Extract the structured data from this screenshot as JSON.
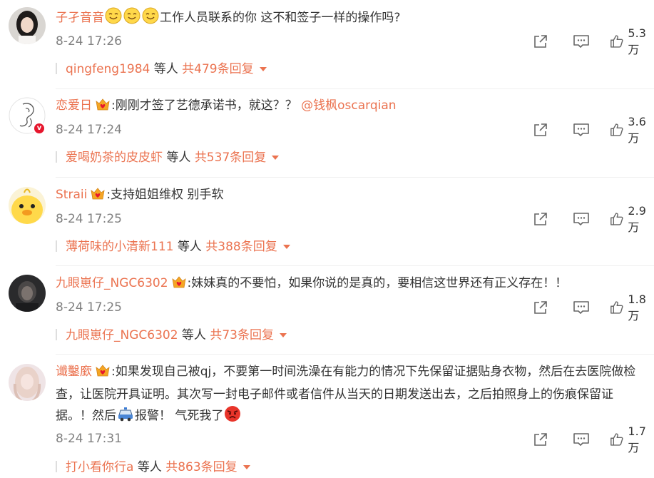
{
  "comments": [
    {
      "user": "子孑音音",
      "emojis": [
        "smile-emoji",
        "smile-emoji",
        "smile-emoji"
      ],
      "text": "工作人员联系的你 这不和签子一样的操作吗?",
      "time": "8-24 17:26",
      "likes": "5.3万",
      "reply_user": "qingfeng1984",
      "reply_mid": " 等人 ",
      "reply_total": "共479条回复"
    },
    {
      "user": "恋爱日",
      "text": ":刚刚才签了艺德承诺书，就这？？",
      "mention": "@钱枫oscarqian",
      "time": "8-24 17:24",
      "likes": "3.6万",
      "reply_user": "爱喝奶茶的皮皮虾",
      "reply_mid": " 等人 ",
      "reply_total": "共537条回复"
    },
    {
      "user": "Straii",
      "text": ":支持姐姐维权 别手软",
      "time": "8-24 17:25",
      "likes": "2.9万",
      "reply_user": "薄荷味的小清新111",
      "reply_mid": " 等人 ",
      "reply_total": "共388条回复"
    },
    {
      "user": "九眼崽仔_NGC6302",
      "text": ":妹妹真的不要怕，如果你说的是真的，要相信这世界还有正义存在！！",
      "time": "8-24 17:25",
      "likes": "1.8万",
      "reply_user": "九眼崽仔_NGC6302",
      "reply_mid": " 等人 ",
      "reply_total": "共73条回复"
    },
    {
      "user": "谶鑿廞",
      "text_a": ":如果发现自己被qj，不要第一时间洗澡在有能力的情况下先保留证据贴身衣物，然后在去医院做检查，让医院开具证明。其次写一封电子邮件或者信件从当天的日期发送出去，之后拍照身上的伤痕保留证据。！然后",
      "text_b": "报警！ 气死我了",
      "time": "8-24 17:31",
      "likes": "1.7万",
      "reply_user": "打小看你行a",
      "reply_mid": " 等人 ",
      "reply_total": "共863条回复"
    }
  ],
  "colors": {
    "accent": "#eb7350",
    "text": "#333333",
    "meta": "#808080",
    "icon": "#666666",
    "verified": "#e6162d"
  },
  "icons": {
    "share": "share-icon",
    "comment": "comment-icon",
    "like": "thumb-up-icon",
    "crown": "crown-heart-icon",
    "caret": "caret-down-icon"
  }
}
